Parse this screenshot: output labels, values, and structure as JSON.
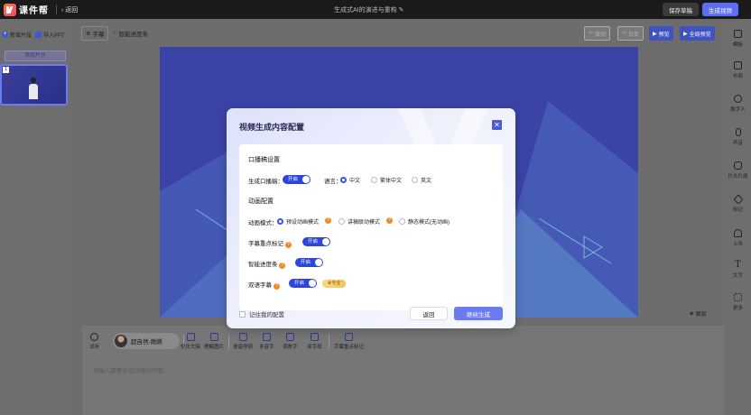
{
  "colors": {
    "accent": "#5b6ef5",
    "toggle_on": "#2d46d9",
    "help": "#f08a24",
    "topbar": "#1a1a1a"
  },
  "topbar": {
    "brand": "课件帮",
    "back_label": "返回",
    "doc_title": "生成式AI的演进与重构",
    "save_draft": "保存草稿",
    "generate_video": "生成视频"
  },
  "left_panel": {
    "new_slide": "新增片段",
    "import_ppt": "导入PPT",
    "add_header": "添加片头",
    "slides": [
      {
        "number": "1"
      }
    ]
  },
  "toolbar": {
    "subtitle": "字幕",
    "smart_progress": "智能进度条",
    "undo": "撤销",
    "redo": "恢复",
    "preview": "预览",
    "full_preview": "全局预览"
  },
  "canvas": {
    "layer_label": "图层"
  },
  "right_sidebar": {
    "items": [
      {
        "label": "模板",
        "icon": "template-icon"
      },
      {
        "label": "布局",
        "icon": "layout-icon"
      },
      {
        "label": "数字人",
        "icon": "avatar-icon"
      },
      {
        "label": "声音",
        "icon": "microphone-icon"
      },
      {
        "label": "片头片尾",
        "icon": "video-icon"
      },
      {
        "label": "标记",
        "icon": "tag-icon"
      },
      {
        "label": "上传",
        "icon": "upload-icon"
      },
      {
        "label": "文字",
        "icon": "text-icon"
      },
      {
        "label": "更多",
        "icon": "more-icon"
      }
    ]
  },
  "bottom_panel": {
    "audition": "试听",
    "voice_name": "超自然-燃燃",
    "tools": [
      "优化文稿",
      "理解图片",
      "语音停顿",
      "多音字",
      "读数字",
      "读字母",
      "字幕重点标记"
    ],
    "placeholder": "请输入需要生成分镜的内容..."
  },
  "modal": {
    "title": "视频生成内容配置",
    "narration_section": "口播稿设置",
    "generate_narration_label": "生成口播稿：",
    "generate_narration_toggle": "开启",
    "language_label": "语言：",
    "languages": [
      "中文",
      "繁体中文",
      "英文"
    ],
    "selected_language": "中文",
    "animation_section": "动画配置",
    "animation_mode_label": "动画模式：",
    "animation_modes": [
      "预设动画模式",
      "讲稿联动模式",
      "静态模式(无动画)"
    ],
    "selected_animation_mode": "预设动画模式",
    "subtitle_highlight_label": "字幕重点标记",
    "subtitle_highlight_toggle": "开启",
    "smart_progress_label": "智能进度条",
    "smart_progress_toggle": "开启",
    "bilingual_label": "双语字幕",
    "bilingual_toggle": "开启",
    "vip_badge": "专业",
    "remember_label": "记住我的配置",
    "back_button": "返回",
    "continue_button": "继续生成"
  }
}
